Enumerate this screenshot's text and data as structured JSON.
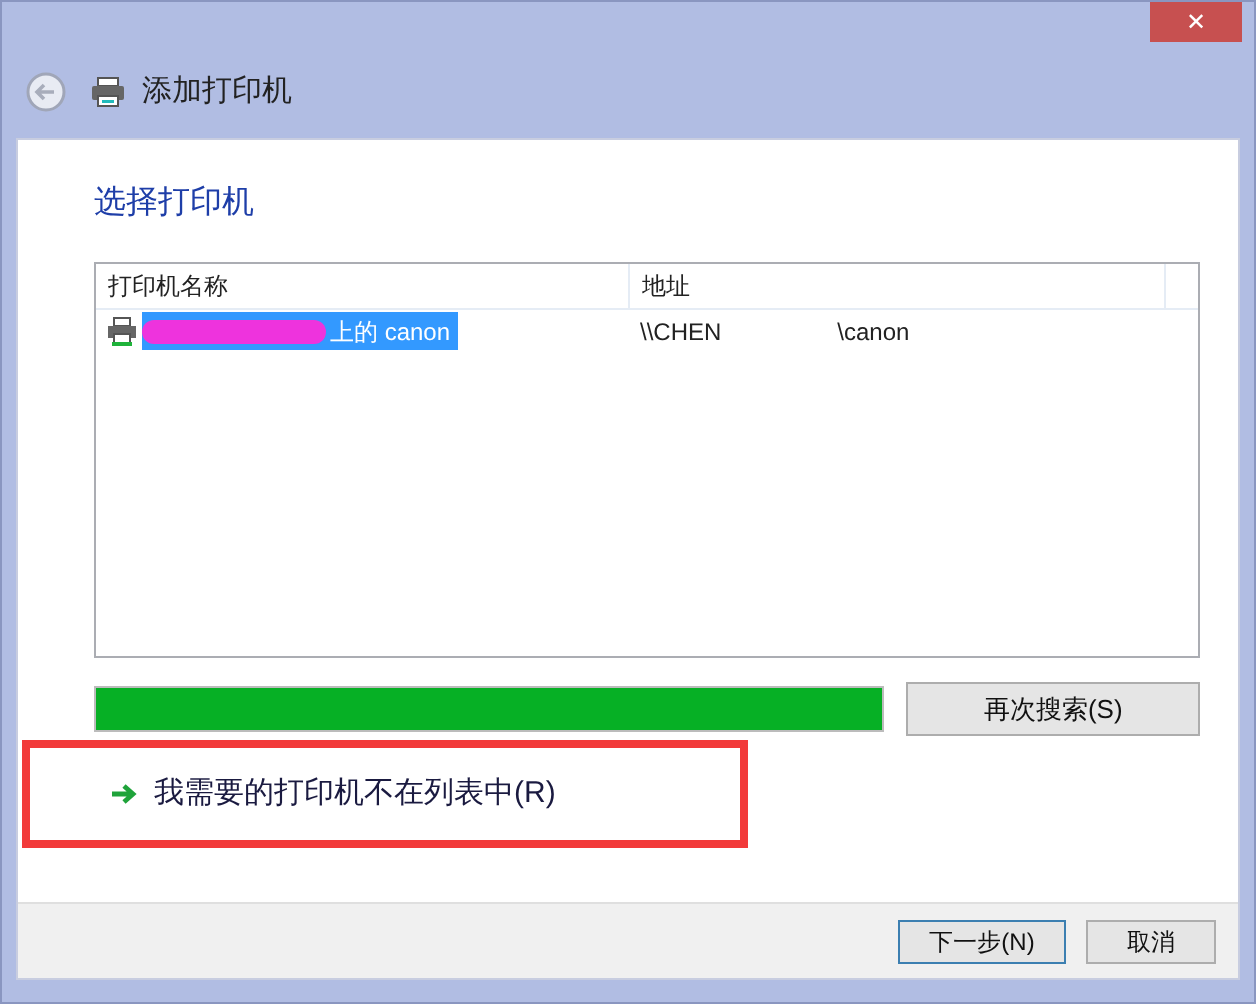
{
  "window": {
    "title": "添加打印机",
    "close_label": "✕"
  },
  "heading": "选择打印机",
  "printer_list": {
    "columns": [
      "打印机名称",
      "地址"
    ],
    "rows": [
      {
        "name": "上的 canon",
        "address_start": "\\\\CHEN",
        "address_end": "\\canon",
        "selected": true
      }
    ]
  },
  "progress": {
    "level": 1
  },
  "search_again_button": "再次搜索(S)",
  "not_listed_link": "我需要的打印机不在列表中(R)",
  "buttons": [
    {
      "label": "下一步(N)",
      "default": true
    },
    {
      "label": "取消",
      "default": false
    }
  ]
}
